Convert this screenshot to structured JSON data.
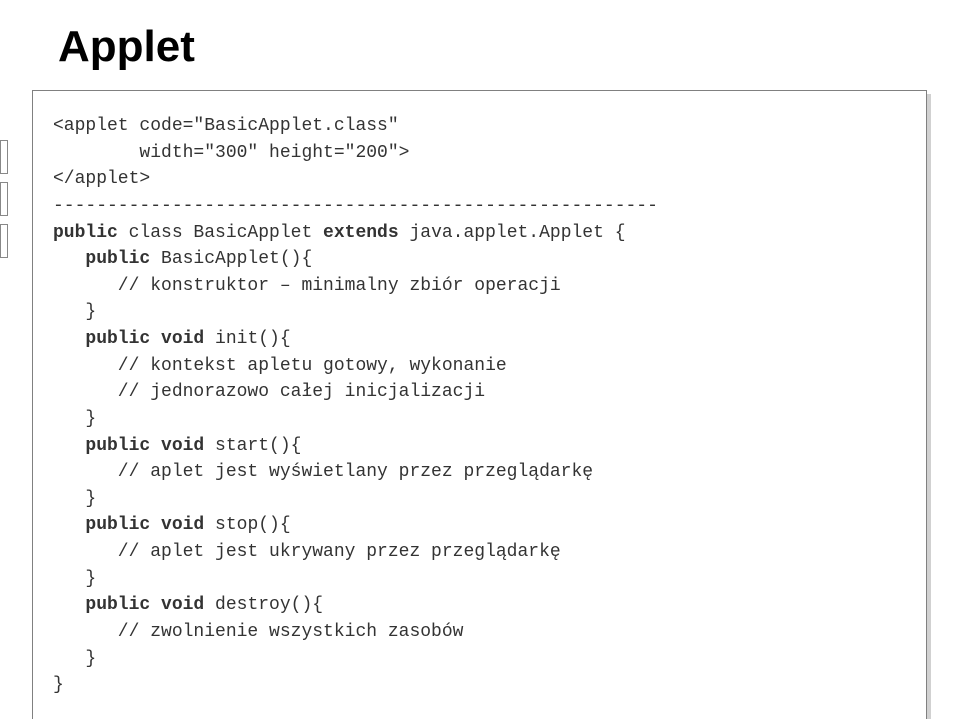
{
  "title": "Applet",
  "code": {
    "line1": "<applet code=\"BasicApplet.class\"",
    "line2": "        width=\"300\" height=\"200\">",
    "line3": "</applet>",
    "line4": "--------------------------------------------------------",
    "line5a": "public",
    "line5b": " class BasicApplet ",
    "line5c": "extends",
    "line5d": " java.applet.Applet {",
    "line6a": "   public",
    "line6b": " BasicApplet(){",
    "line7": "      // konstruktor – minimalny zbiór operacji",
    "line8": "   }",
    "line9a": "   public void",
    "line9b": " init(){",
    "line10": "      // kontekst apletu gotowy, wykonanie",
    "line11": "      // jednorazowo całej inicjalizacji",
    "line12": "   }",
    "line13a": "   public void",
    "line13b": " start(){",
    "line14": "      // aplet jest wyświetlany przez przeglądarkę",
    "line15": "   }",
    "line16a": "   public void",
    "line16b": " stop(){",
    "line17": "      // aplet jest ukrywany przez przeglądarkę",
    "line18": "   }",
    "line19a": "   public void",
    "line19b": " destroy(){",
    "line20": "      // zwolnienie wszystkich zasobów",
    "line21": "   }",
    "line22": "}"
  }
}
